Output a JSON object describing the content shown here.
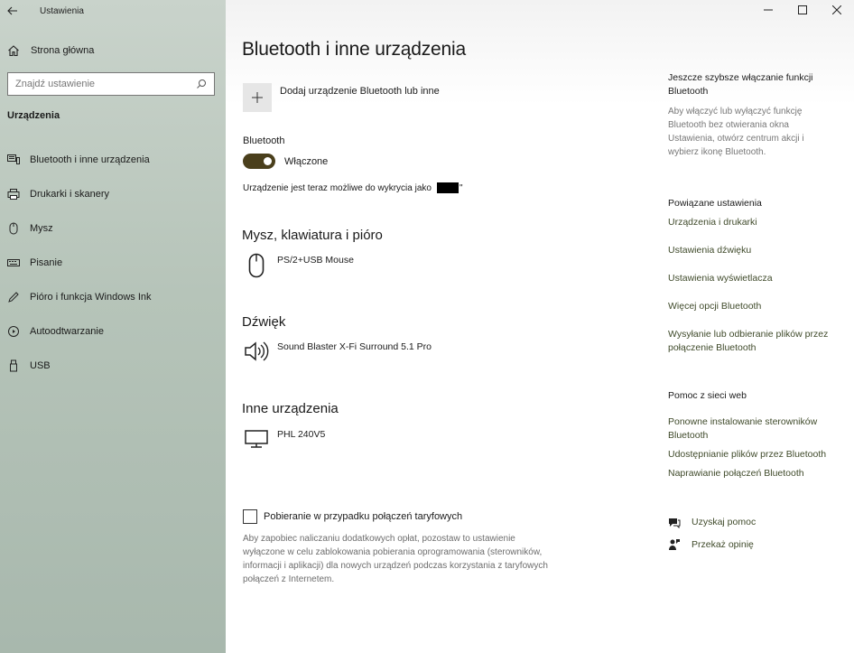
{
  "window": {
    "app_title": "Ustawienia",
    "back_icon": "back-arrow-icon",
    "controls": [
      "minimize-icon",
      "maximize-icon",
      "close-icon"
    ]
  },
  "sidebar": {
    "home_label": "Strona główna",
    "search_placeholder": "Znajdź ustawienie",
    "section_label": "Urządzenia",
    "items": [
      {
        "label": "Bluetooth i inne urządzenia",
        "icon": "bluetooth-devices-icon"
      },
      {
        "label": "Drukarki i skanery",
        "icon": "printer-icon"
      },
      {
        "label": "Mysz",
        "icon": "mouse-icon"
      },
      {
        "label": "Pisanie",
        "icon": "keyboard-icon"
      },
      {
        "label": "Pióro i funkcja Windows Ink",
        "icon": "pen-icon"
      },
      {
        "label": "Autoodtwarzanie",
        "icon": "autoplay-icon"
      },
      {
        "label": "USB",
        "icon": "usb-icon"
      }
    ]
  },
  "main": {
    "title": "Bluetooth i inne urządzenia",
    "add_device_label": "Dodaj urządzenie Bluetooth lub inne",
    "bluetooth_label": "Bluetooth",
    "bluetooth_state": "Włączone",
    "bluetooth_on": true,
    "discoverable_text": "Urządzenie jest teraz możliwe do wykrycia jako",
    "discoverable_tail": "\"",
    "groups": {
      "mouse": {
        "title": "Mysz, klawiatura i pióro",
        "device": "PS/2+USB Mouse",
        "icon": "mouse-icon"
      },
      "audio": {
        "title": "Dźwięk",
        "device": "Sound Blaster X-Fi Surround 5.1 Pro",
        "icon": "speaker-icon"
      },
      "other": {
        "title": "Inne urządzenia",
        "device": "PHL 240V5",
        "icon": "monitor-icon"
      }
    },
    "metered_label": "Pobieranie w przypadku połączeń taryfowych",
    "metered_checked": false,
    "metered_desc": "Aby zapobiec naliczaniu dodatkowych opłat, pozostaw to ustawienie wyłączone w celu zablokowania pobierania oprogramowania (sterowników, informacji i aplikacji) dla nowych urządzeń podczas korzystania z taryfowych połączeń z Internetem."
  },
  "right": {
    "quick_heading": "Jeszcze szybsze włączanie funkcji Bluetooth",
    "quick_text": "Aby włączyć lub wyłączyć funkcję Bluetooth bez otwierania okna Ustawienia, otwórz centrum akcji i wybierz ikonę Bluetooth.",
    "related_heading": "Powiązane ustawienia",
    "related_links": [
      "Urządzenia i drukarki",
      "Ustawienia dźwięku",
      "Ustawienia wyświetlacza",
      "Więcej opcji Bluetooth",
      "Wysyłanie lub odbieranie plików przez połączenie Bluetooth"
    ],
    "web_heading": "Pomoc z sieci web",
    "web_links": [
      "Ponowne instalowanie sterowników Bluetooth",
      "Udostępnianie plików przez Bluetooth",
      "Naprawianie połączeń Bluetooth"
    ],
    "get_help": "Uzyskaj pomoc",
    "feedback": "Przekaż opinię"
  }
}
